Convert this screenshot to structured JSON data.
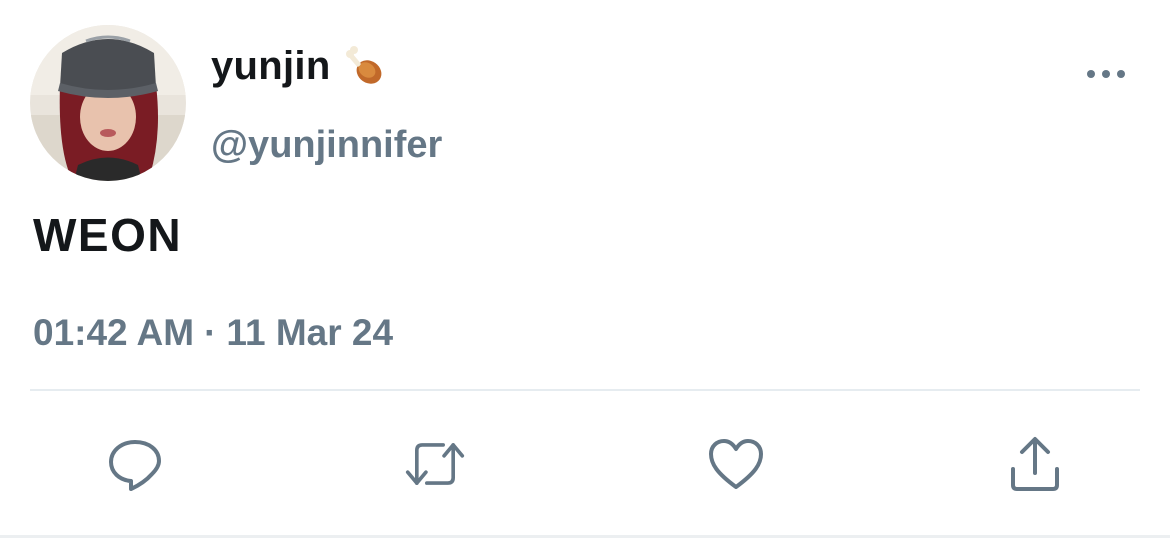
{
  "tweet": {
    "author": {
      "display_name": "yunjin",
      "name_emoji": "poultry-leg-emoji",
      "handle": "@yunjinnifer",
      "avatar": "profile-photo"
    },
    "text": "WEON",
    "time": "01:42 AM",
    "separator": "·",
    "date": "11 Mar 24",
    "menu_icon": "more-horizontal-icon",
    "actions": [
      {
        "icon": "reply-icon"
      },
      {
        "icon": "retweet-icon"
      },
      {
        "icon": "like-icon"
      },
      {
        "icon": "share-icon"
      }
    ]
  },
  "colors": {
    "text_primary": "#14171a",
    "text_secondary": "#657786",
    "divider": "#e6ecf0",
    "background": "#ffffff"
  }
}
